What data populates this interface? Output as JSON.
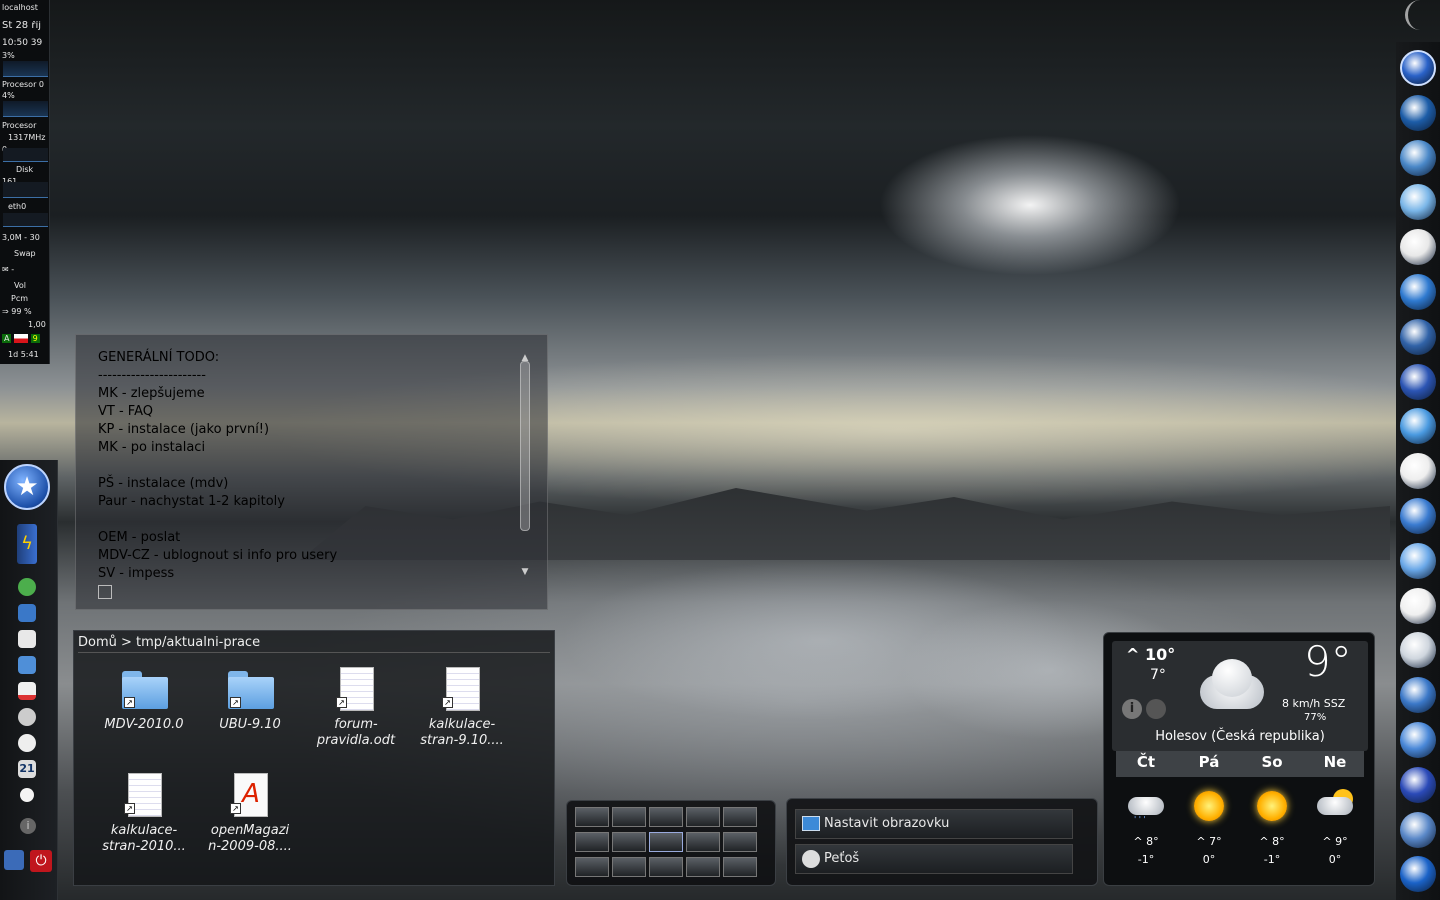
{
  "system_monitor": {
    "hostname": "localhost",
    "date": "St 28 říj",
    "time": "10:50 39",
    "cpu1_percent": "3%",
    "cpu1_label": "Procesor 0",
    "cpu2_percent": "4%",
    "cpu2_label": "Procesor",
    "freq": "1317MHz",
    "disk_value": "0",
    "disk_label": "Disk",
    "net_value": "161",
    "net_label": "eth0",
    "mem": "3,0M - 30",
    "swap_label": "Swap",
    "mail": "-",
    "vol_label": "Vol",
    "pcm_label": "Pcm",
    "battery": "99 %",
    "load": "1,00",
    "keyboard_layout": "A",
    "desktop_number": "9",
    "uptime": "1d 5:41"
  },
  "note": {
    "lines": [
      "GENERÁLNÍ TODO:",
      "-----------------------",
      "MK - zlepšujeme",
      "VT - FAQ",
      "KP - instalace (jako první!)",
      "MK - po instalaci",
      "",
      "PŠ - instalace (mdv)",
      "Paur - nachystat 1-2 kapitoly",
      "",
      "OEM - poslat",
      "MDV-CZ - ublognout si info pro usery",
      "SV - impess"
    ]
  },
  "folder_view": {
    "breadcrumb": "Domů > tmp/aktualni-prace",
    "items": [
      {
        "label": "MDV-2010.0",
        "type": "folder"
      },
      {
        "label": "UBU-9.10",
        "type": "folder"
      },
      {
        "label": "forum-\npravidla.odt",
        "type": "document"
      },
      {
        "label": "kalkulace-\nstran-9.10....",
        "type": "spreadsheet"
      },
      {
        "label": "kalkulace-\nstran-2010...",
        "type": "spreadsheet"
      },
      {
        "label": "openMagazi\nn-2009-08....",
        "type": "pdf"
      }
    ]
  },
  "tasks": {
    "items": [
      {
        "label": "Nastavit obrazovku",
        "icon": "monitor-icon"
      },
      {
        "label": "Peťoš",
        "icon": "tux-icon"
      }
    ]
  },
  "weather": {
    "high": "^ 10°",
    "low": "7°",
    "current_temp": "9°",
    "wind": "8 km/h SSZ",
    "humidity": "77%",
    "location": "Holesov (Česká republika)",
    "forecast": [
      {
        "day": "Čt",
        "high": "^ 8°",
        "low": "-1°",
        "icon": "rain-cloud-icon"
      },
      {
        "day": "Pá",
        "high": "^ 7°",
        "low": "0°",
        "icon": "sun-icon"
      },
      {
        "day": "So",
        "high": "^ 8°",
        "low": "-1°",
        "icon": "sun-icon"
      },
      {
        "day": "Ne",
        "high": "^ 9°",
        "low": "0°",
        "icon": "sun-cloud-icon"
      }
    ]
  },
  "dock": {
    "items": [
      "kde-menu-icon",
      "desktop-icon",
      "network-monitor-icon",
      "tools-icon",
      "files-icon",
      "browser-icon",
      "firefox-icon",
      "ubuntu-icon",
      "mail-icon",
      "text-editor-icon",
      "media-icon",
      "screen-icon",
      "amarok-icon",
      "disc-icon",
      "network-icon",
      "debian-icon",
      "mdv-icon",
      "security-icon",
      "hp-icon"
    ]
  }
}
